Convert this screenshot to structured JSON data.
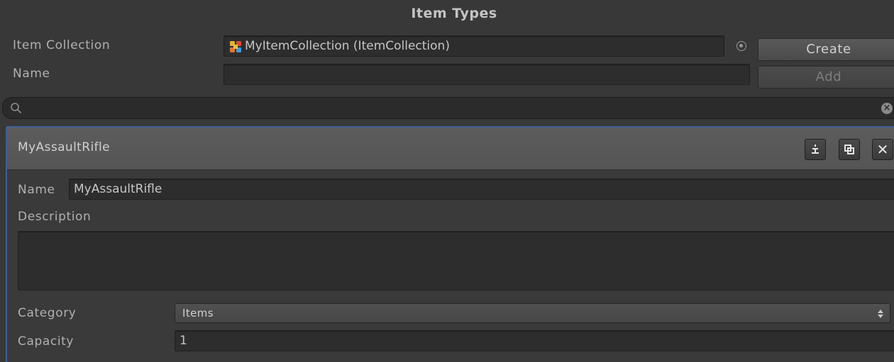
{
  "header": {
    "title": "Item Types"
  },
  "collection": {
    "label": "Item Collection",
    "value": "MyItemCollection (ItemCollection)",
    "create_label": "Create"
  },
  "name_row": {
    "label": "Name",
    "value": "",
    "add_label": "Add"
  },
  "search": {
    "value": ""
  },
  "item": {
    "header_title": "MyAssaultRifle",
    "name_label": "Name",
    "name_value": "MyAssaultRifle",
    "description_label": "Description",
    "description_value": "",
    "category_label": "Category",
    "category_value": "Items",
    "capacity_label": "Capacity",
    "capacity_value": "1"
  },
  "icons": {
    "object_picker": "circle-dot-icon",
    "search": "magnifier-icon",
    "clear": "clear-x-icon",
    "move": "move-down-icon",
    "duplicate": "duplicate-icon",
    "close": "close-icon",
    "dropdown": "up-down-arrow-icon"
  },
  "colors": {
    "background": "#383838",
    "panel_border": "#3e5f96",
    "panel_header": "#595959"
  }
}
